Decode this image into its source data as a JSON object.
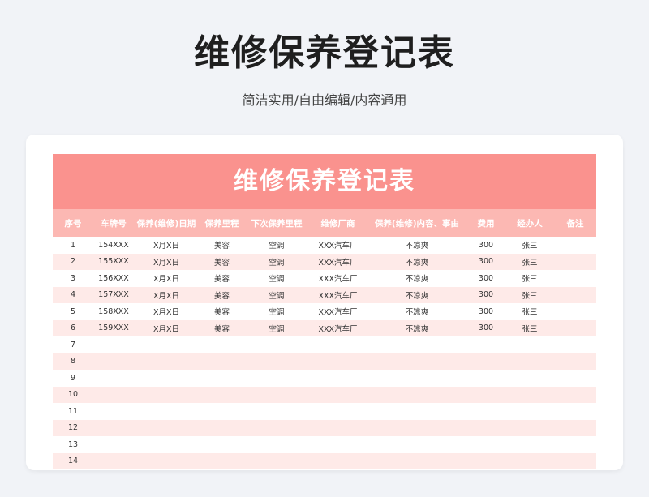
{
  "page": {
    "title": "维修保养登记表",
    "subtitle": "简洁实用/自由编辑/内容通用"
  },
  "sheet": {
    "title": "维修保养登记表",
    "columns": [
      "序号",
      "车牌号",
      "保养(维修)日期",
      "保养里程",
      "下次保养里程",
      "维修厂商",
      "保养(维修)内容、事由",
      "费用",
      "经办人",
      "备注"
    ],
    "rows": [
      [
        "1",
        "154XXX",
        "X月X日",
        "美容",
        "空调",
        "XXX汽车厂",
        "不凉爽",
        "300",
        "张三",
        ""
      ],
      [
        "2",
        "155XXX",
        "X月X日",
        "美容",
        "空调",
        "XXX汽车厂",
        "不凉爽",
        "300",
        "张三",
        ""
      ],
      [
        "3",
        "156XXX",
        "X月X日",
        "美容",
        "空调",
        "XXX汽车厂",
        "不凉爽",
        "300",
        "张三",
        ""
      ],
      [
        "4",
        "157XXX",
        "X月X日",
        "美容",
        "空调",
        "XXX汽车厂",
        "不凉爽",
        "300",
        "张三",
        ""
      ],
      [
        "5",
        "158XXX",
        "X月X日",
        "美容",
        "空调",
        "XXX汽车厂",
        "不凉爽",
        "300",
        "张三",
        ""
      ],
      [
        "6",
        "159XXX",
        "X月X日",
        "美容",
        "空调",
        "XXX汽车厂",
        "不凉爽",
        "300",
        "张三",
        ""
      ],
      [
        "7",
        "",
        "",
        "",
        "",
        "",
        "",
        "",
        "",
        ""
      ],
      [
        "8",
        "",
        "",
        "",
        "",
        "",
        "",
        "",
        "",
        ""
      ],
      [
        "9",
        "",
        "",
        "",
        "",
        "",
        "",
        "",
        "",
        ""
      ],
      [
        "10",
        "",
        "",
        "",
        "",
        "",
        "",
        "",
        "",
        ""
      ],
      [
        "11",
        "",
        "",
        "",
        "",
        "",
        "",
        "",
        "",
        ""
      ],
      [
        "12",
        "",
        "",
        "",
        "",
        "",
        "",
        "",
        "",
        ""
      ],
      [
        "13",
        "",
        "",
        "",
        "",
        "",
        "",
        "",
        "",
        ""
      ],
      [
        "14",
        "",
        "",
        "",
        "",
        "",
        "",
        "",
        "",
        ""
      ]
    ]
  },
  "colors": {
    "title_band": "#fa928e",
    "header_band": "#fcb8b3",
    "stripe": "#feeae8",
    "background": "#f1f3f7"
  }
}
